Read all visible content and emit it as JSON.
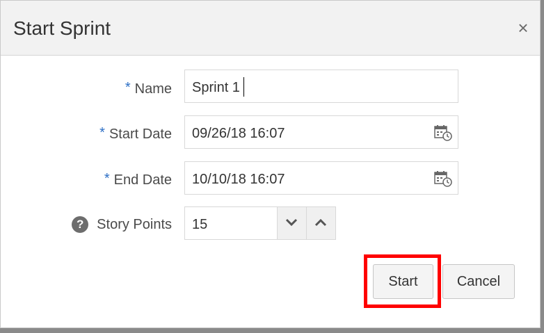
{
  "dialog": {
    "title": "Start Sprint",
    "close_glyph": "×"
  },
  "form": {
    "required_marker": "*",
    "name": {
      "label": "Name",
      "value": "Sprint 1"
    },
    "start_date": {
      "label": "Start Date",
      "value": "09/26/18 16:07",
      "icon": "calendar-clock-icon"
    },
    "end_date": {
      "label": "End Date",
      "value": "10/10/18 16:07",
      "icon": "calendar-clock-icon"
    },
    "story_points": {
      "label": "Story Points",
      "value": "15",
      "help_glyph": "?"
    }
  },
  "buttons": {
    "start": "Start",
    "cancel": "Cancel"
  },
  "colors": {
    "required": "#2d6fc5",
    "highlight": "#ff0000"
  }
}
